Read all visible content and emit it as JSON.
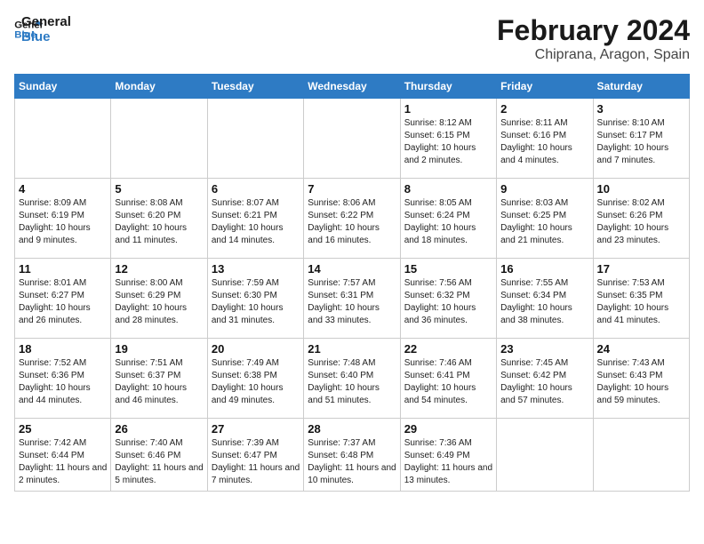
{
  "header": {
    "logo_general": "General",
    "logo_blue": "Blue",
    "month_title": "February 2024",
    "location": "Chiprana, Aragon, Spain"
  },
  "weekdays": [
    "Sunday",
    "Monday",
    "Tuesday",
    "Wednesday",
    "Thursday",
    "Friday",
    "Saturday"
  ],
  "weeks": [
    [
      {
        "day": "",
        "info": ""
      },
      {
        "day": "",
        "info": ""
      },
      {
        "day": "",
        "info": ""
      },
      {
        "day": "",
        "info": ""
      },
      {
        "day": "1",
        "info": "Sunrise: 8:12 AM\nSunset: 6:15 PM\nDaylight: 10 hours and 2 minutes."
      },
      {
        "day": "2",
        "info": "Sunrise: 8:11 AM\nSunset: 6:16 PM\nDaylight: 10 hours and 4 minutes."
      },
      {
        "day": "3",
        "info": "Sunrise: 8:10 AM\nSunset: 6:17 PM\nDaylight: 10 hours and 7 minutes."
      }
    ],
    [
      {
        "day": "4",
        "info": "Sunrise: 8:09 AM\nSunset: 6:19 PM\nDaylight: 10 hours and 9 minutes."
      },
      {
        "day": "5",
        "info": "Sunrise: 8:08 AM\nSunset: 6:20 PM\nDaylight: 10 hours and 11 minutes."
      },
      {
        "day": "6",
        "info": "Sunrise: 8:07 AM\nSunset: 6:21 PM\nDaylight: 10 hours and 14 minutes."
      },
      {
        "day": "7",
        "info": "Sunrise: 8:06 AM\nSunset: 6:22 PM\nDaylight: 10 hours and 16 minutes."
      },
      {
        "day": "8",
        "info": "Sunrise: 8:05 AM\nSunset: 6:24 PM\nDaylight: 10 hours and 18 minutes."
      },
      {
        "day": "9",
        "info": "Sunrise: 8:03 AM\nSunset: 6:25 PM\nDaylight: 10 hours and 21 minutes."
      },
      {
        "day": "10",
        "info": "Sunrise: 8:02 AM\nSunset: 6:26 PM\nDaylight: 10 hours and 23 minutes."
      }
    ],
    [
      {
        "day": "11",
        "info": "Sunrise: 8:01 AM\nSunset: 6:27 PM\nDaylight: 10 hours and 26 minutes."
      },
      {
        "day": "12",
        "info": "Sunrise: 8:00 AM\nSunset: 6:29 PM\nDaylight: 10 hours and 28 minutes."
      },
      {
        "day": "13",
        "info": "Sunrise: 7:59 AM\nSunset: 6:30 PM\nDaylight: 10 hours and 31 minutes."
      },
      {
        "day": "14",
        "info": "Sunrise: 7:57 AM\nSunset: 6:31 PM\nDaylight: 10 hours and 33 minutes."
      },
      {
        "day": "15",
        "info": "Sunrise: 7:56 AM\nSunset: 6:32 PM\nDaylight: 10 hours and 36 minutes."
      },
      {
        "day": "16",
        "info": "Sunrise: 7:55 AM\nSunset: 6:34 PM\nDaylight: 10 hours and 38 minutes."
      },
      {
        "day": "17",
        "info": "Sunrise: 7:53 AM\nSunset: 6:35 PM\nDaylight: 10 hours and 41 minutes."
      }
    ],
    [
      {
        "day": "18",
        "info": "Sunrise: 7:52 AM\nSunset: 6:36 PM\nDaylight: 10 hours and 44 minutes."
      },
      {
        "day": "19",
        "info": "Sunrise: 7:51 AM\nSunset: 6:37 PM\nDaylight: 10 hours and 46 minutes."
      },
      {
        "day": "20",
        "info": "Sunrise: 7:49 AM\nSunset: 6:38 PM\nDaylight: 10 hours and 49 minutes."
      },
      {
        "day": "21",
        "info": "Sunrise: 7:48 AM\nSunset: 6:40 PM\nDaylight: 10 hours and 51 minutes."
      },
      {
        "day": "22",
        "info": "Sunrise: 7:46 AM\nSunset: 6:41 PM\nDaylight: 10 hours and 54 minutes."
      },
      {
        "day": "23",
        "info": "Sunrise: 7:45 AM\nSunset: 6:42 PM\nDaylight: 10 hours and 57 minutes."
      },
      {
        "day": "24",
        "info": "Sunrise: 7:43 AM\nSunset: 6:43 PM\nDaylight: 10 hours and 59 minutes."
      }
    ],
    [
      {
        "day": "25",
        "info": "Sunrise: 7:42 AM\nSunset: 6:44 PM\nDaylight: 11 hours and 2 minutes."
      },
      {
        "day": "26",
        "info": "Sunrise: 7:40 AM\nSunset: 6:46 PM\nDaylight: 11 hours and 5 minutes."
      },
      {
        "day": "27",
        "info": "Sunrise: 7:39 AM\nSunset: 6:47 PM\nDaylight: 11 hours and 7 minutes."
      },
      {
        "day": "28",
        "info": "Sunrise: 7:37 AM\nSunset: 6:48 PM\nDaylight: 11 hours and 10 minutes."
      },
      {
        "day": "29",
        "info": "Sunrise: 7:36 AM\nSunset: 6:49 PM\nDaylight: 11 hours and 13 minutes."
      },
      {
        "day": "",
        "info": ""
      },
      {
        "day": "",
        "info": ""
      }
    ]
  ]
}
